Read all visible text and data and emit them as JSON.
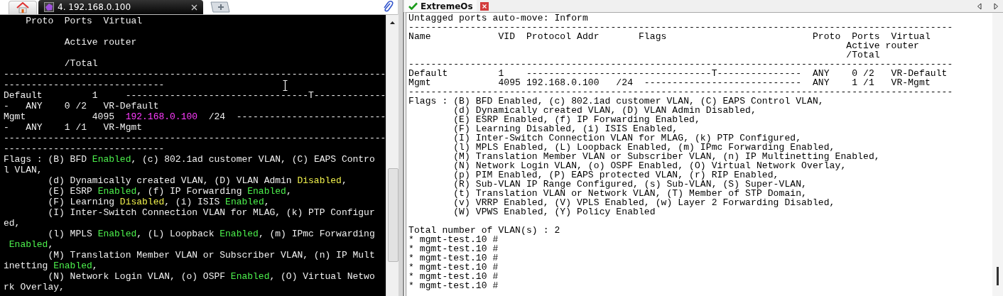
{
  "left_pane": {
    "tabs": [
      {
        "kind": "home",
        "selected": false
      },
      {
        "kind": "session",
        "label": "4. 192.168.0.100",
        "selected": true
      }
    ],
    "terminal": {
      "lines": [
        {
          "kind": "text",
          "segments": [
            "    Proto  Ports  Virtual"
          ]
        },
        {
          "kind": "blank"
        },
        {
          "kind": "text",
          "segments": [
            "           Active router"
          ]
        },
        {
          "kind": "blank"
        },
        {
          "kind": "text",
          "segments": [
            "           /Total"
          ]
        },
        {
          "kind": "text",
          "segments": [
            "---------------------------------------------------------------------"
          ]
        },
        {
          "kind": "text",
          "segments": [
            "-----------------------------"
          ]
        },
        {
          "kind": "text",
          "segments": [
            "Default         1     ---------------------------------T-------------"
          ]
        },
        {
          "kind": "text",
          "segments": [
            "-   ANY    0 /2   VR-Default"
          ]
        },
        {
          "kind": "text",
          "segments": [
            "Mgmt            4095  ",
            {
              "text": "192.168.0.100",
              "color": "#ff3cff"
            },
            "  /24  ---------------------------"
          ]
        },
        {
          "kind": "text",
          "segments": [
            "-   ANY    1 /1   VR-Mgmt"
          ]
        },
        {
          "kind": "text",
          "segments": [
            "---------------------------------------------------------------------"
          ]
        },
        {
          "kind": "text",
          "segments": [
            "-----------------------------"
          ]
        },
        {
          "kind": "text",
          "segments": [
            "Flags : (B) BFD ",
            {
              "text": "Enabled",
              "color": "#4cf04c"
            },
            ", (c) 802.1ad customer VLAN, (C) EAPS Contro"
          ]
        },
        {
          "kind": "text",
          "segments": [
            "l VLAN,"
          ]
        },
        {
          "kind": "text",
          "segments": [
            "        (d) Dynamically created VLAN, (D) VLAN Admin ",
            {
              "text": "Disabled",
              "color": "#f0f04c"
            },
            ","
          ]
        },
        {
          "kind": "text",
          "segments": [
            "        (E) ESRP ",
            {
              "text": "Enabled",
              "color": "#4cf04c"
            },
            ", (f) IP Forwarding ",
            {
              "text": "Enabled",
              "color": "#4cf04c"
            },
            ","
          ]
        },
        {
          "kind": "text",
          "segments": [
            "        (F) Learning ",
            {
              "text": "Disabled",
              "color": "#f0f04c"
            },
            ", (i) ISIS ",
            {
              "text": "Enabled",
              "color": "#4cf04c"
            },
            ","
          ]
        },
        {
          "kind": "text",
          "segments": [
            "        (I) Inter-Switch Connection VLAN for MLAG, (k) PTP Configur"
          ]
        },
        {
          "kind": "text",
          "segments": [
            "ed,"
          ]
        },
        {
          "kind": "text",
          "segments": [
            "        (l) MPLS ",
            {
              "text": "Enabled",
              "color": "#4cf04c"
            },
            ", (L) Loopback ",
            {
              "text": "Enabled",
              "color": "#4cf04c"
            },
            ", (m) IPmc Forwarding"
          ]
        },
        {
          "kind": "text",
          "segments": [
            {
              "text": " Enabled",
              "color": "#4cf04c"
            },
            ","
          ]
        },
        {
          "kind": "text",
          "segments": [
            "        (M) Translation Member VLAN or Subscriber VLAN, (n) IP Mult"
          ]
        },
        {
          "kind": "text",
          "segments": [
            "inetting ",
            {
              "text": "Enabled",
              "color": "#4cf04c"
            },
            ","
          ]
        },
        {
          "kind": "text",
          "segments": [
            "        (N) Network Login VLAN, (o) OSPF ",
            {
              "text": "Enabled",
              "color": "#4cf04c"
            },
            ", (O) Virtual Netwo"
          ]
        },
        {
          "kind": "text",
          "segments": [
            "rk Overlay,"
          ]
        }
      ]
    }
  },
  "right_pane": {
    "tab": {
      "label": "ExtremeOs",
      "connected": true
    },
    "terminal": {
      "lines": [
        {
          "kind": "text",
          "text": "Untagged ports auto-move: Inform"
        },
        {
          "kind": "text",
          "text": "-------------------------------------------------------------------------------------------------"
        },
        {
          "kind": "text",
          "text": "Name            VID  Protocol Addr       Flags                          Proto  Ports  Virtual"
        },
        {
          "kind": "text",
          "text": "                                                                              Active router"
        },
        {
          "kind": "text",
          "text": "                                                                              /Total"
        },
        {
          "kind": "text",
          "text": "-------------------------------------------------------------------------------------------------"
        },
        {
          "kind": "text",
          "text": "Default         1    ---------------------------------T---------------  ANY    0 /2   VR-Default"
        },
        {
          "kind": "text",
          "text": "Mgmt            4095 192.168.0.100   /24  ----------------------------  ANY    1 /1   VR-Mgmt"
        },
        {
          "kind": "text",
          "text": "-------------------------------------------------------------------------------------------------"
        },
        {
          "kind": "text",
          "text": "Flags : (B) BFD Enabled, (c) 802.1ad customer VLAN, (C) EAPS Control VLAN,"
        },
        {
          "kind": "text",
          "text": "        (d) Dynamically created VLAN, (D) VLAN Admin Disabled,"
        },
        {
          "kind": "text",
          "text": "        (E) ESRP Enabled, (f) IP Forwarding Enabled,"
        },
        {
          "kind": "text",
          "text": "        (F) Learning Disabled, (i) ISIS Enabled,"
        },
        {
          "kind": "text",
          "text": "        (I) Inter-Switch Connection VLAN for MLAG, (k) PTP Configured,"
        },
        {
          "kind": "text",
          "text": "        (l) MPLS Enabled, (L) Loopback Enabled, (m) IPmc Forwarding Enabled,"
        },
        {
          "kind": "text",
          "text": "        (M) Translation Member VLAN or Subscriber VLAN, (n) IP Multinetting Enabled,"
        },
        {
          "kind": "text",
          "text": "        (N) Network Login VLAN, (o) OSPF Enabled, (O) Virtual Network Overlay,"
        },
        {
          "kind": "text",
          "text": "        (p) PIM Enabled, (P) EAPS protected VLAN, (r) RIP Enabled,"
        },
        {
          "kind": "text",
          "text": "        (R) Sub-VLAN IP Range Configured, (s) Sub-VLAN, (S) Super-VLAN,"
        },
        {
          "kind": "text",
          "text": "        (t) Translation VLAN or Network VLAN, (T) Member of STP Domain,"
        },
        {
          "kind": "text",
          "text": "        (v) VRRP Enabled, (V) VPLS Enabled, (w) Layer 2 Forwarding Disabled,"
        },
        {
          "kind": "text",
          "text": "        (W) VPWS Enabled, (Y) Policy Enabled"
        },
        {
          "kind": "blank"
        },
        {
          "kind": "text",
          "text": "Total number of VLAN(s) : 2"
        },
        {
          "kind": "text",
          "text": "* mgmt-test.10 #"
        },
        {
          "kind": "text",
          "text": "* mgmt-test.10 #"
        },
        {
          "kind": "text",
          "text": "* mgmt-test.10 #"
        },
        {
          "kind": "text",
          "text": "* mgmt-test.10 #"
        },
        {
          "kind": "text",
          "text": "* mgmt-test.10 #"
        },
        {
          "kind": "text",
          "text": "* mgmt-test.10 #"
        }
      ]
    }
  }
}
